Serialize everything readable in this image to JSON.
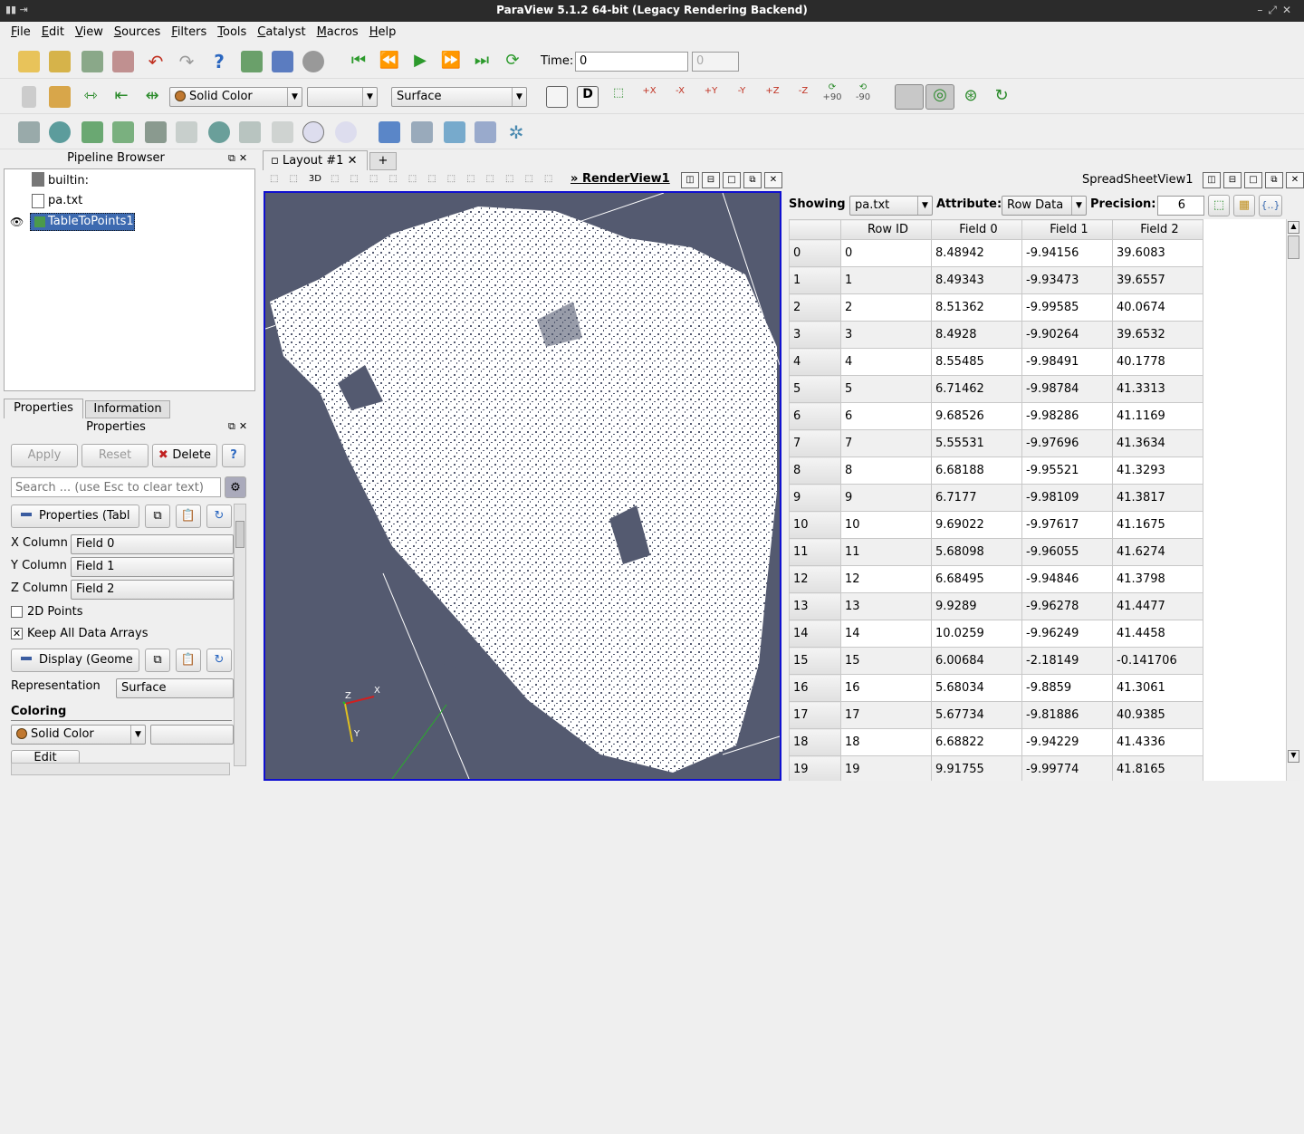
{
  "window": {
    "title": "ParaView 5.1.2 64-bit (Legacy Rendering Backend)"
  },
  "menu": [
    "File",
    "Edit",
    "View",
    "Sources",
    "Filters",
    "Tools",
    "Catalyst",
    "Macros",
    "Help"
  ],
  "toolbar": {
    "time_label": "Time:",
    "time_value": "0",
    "time_index": "0",
    "color_by": "Solid Color",
    "representation": "Surface",
    "rot_plus": "+90",
    "rot_minus": "-90"
  },
  "pipeline": {
    "title": "Pipeline Browser",
    "items": [
      "builtin:",
      "pa.txt",
      "TableToPoints1"
    ]
  },
  "props": {
    "tabs": [
      "Properties",
      "Information"
    ],
    "title": "Properties",
    "apply": "Apply",
    "reset": "Reset",
    "delete": "Delete",
    "help": "?",
    "search_placeholder": "Search ... (use Esc to clear text)",
    "section1": "Properties (Tabl",
    "x_label": "X Column",
    "x_value": "Field 0",
    "y_label": "Y Column",
    "y_value": "Field 1",
    "z_label": "Z Column",
    "z_value": "Field 2",
    "points2d": "2D Points",
    "keep": "Keep All Data Arrays",
    "section2": "Display (Geome",
    "rep_label": "Representation",
    "rep_value": "Surface",
    "coloring": "Coloring",
    "color_value": "Solid Color",
    "edit": "Edit"
  },
  "layout": {
    "tab": "Layout #1",
    "add": "+",
    "render_view": "RenderView1",
    "threed": "3D",
    "axes": {
      "x": "X",
      "y": "Y",
      "z": "Z"
    }
  },
  "spreadsheet": {
    "title": "SpreadSheetView1",
    "showing_label": "Showing",
    "showing_value": "pa.txt",
    "attribute_label": "Attribute:",
    "attribute_value": "Row Data",
    "precision_label": "Precision:",
    "precision_value": "6",
    "columns": [
      "Row ID",
      "Field 0",
      "Field 1",
      "Field 2"
    ],
    "rows": [
      [
        "0",
        "0",
        "8.48942",
        "-9.94156",
        "39.6083"
      ],
      [
        "1",
        "1",
        "8.49343",
        "-9.93473",
        "39.6557"
      ],
      [
        "2",
        "2",
        "8.51362",
        "-9.99585",
        "40.0674"
      ],
      [
        "3",
        "3",
        "8.4928",
        "-9.90264",
        "39.6532"
      ],
      [
        "4",
        "4",
        "8.55485",
        "-9.98491",
        "40.1778"
      ],
      [
        "5",
        "5",
        "6.71462",
        "-9.98784",
        "41.3313"
      ],
      [
        "6",
        "6",
        "9.68526",
        "-9.98286",
        "41.1169"
      ],
      [
        "7",
        "7",
        "5.55531",
        "-9.97696",
        "41.3634"
      ],
      [
        "8",
        "8",
        "6.68188",
        "-9.95521",
        "41.3293"
      ],
      [
        "9",
        "9",
        "6.7177",
        "-9.98109",
        "41.3817"
      ],
      [
        "10",
        "10",
        "9.69022",
        "-9.97617",
        "41.1675"
      ],
      [
        "11",
        "11",
        "5.68098",
        "-9.96055",
        "41.6274"
      ],
      [
        "12",
        "12",
        "6.68495",
        "-9.94846",
        "41.3798"
      ],
      [
        "13",
        "13",
        "9.9289",
        "-9.96278",
        "41.4477"
      ],
      [
        "14",
        "14",
        "10.0259",
        "-9.96249",
        "41.4458"
      ],
      [
        "15",
        "15",
        "6.00684",
        "-2.18149",
        "-0.141706"
      ],
      [
        "16",
        "16",
        "5.68034",
        "-9.8859",
        "41.3061"
      ],
      [
        "17",
        "17",
        "5.67734",
        "-9.81886",
        "40.9385"
      ],
      [
        "18",
        "18",
        "6.68822",
        "-9.94229",
        "41.4336"
      ],
      [
        "19",
        "19",
        "9.91755",
        "-9.99774",
        "41.8165"
      ]
    ]
  }
}
